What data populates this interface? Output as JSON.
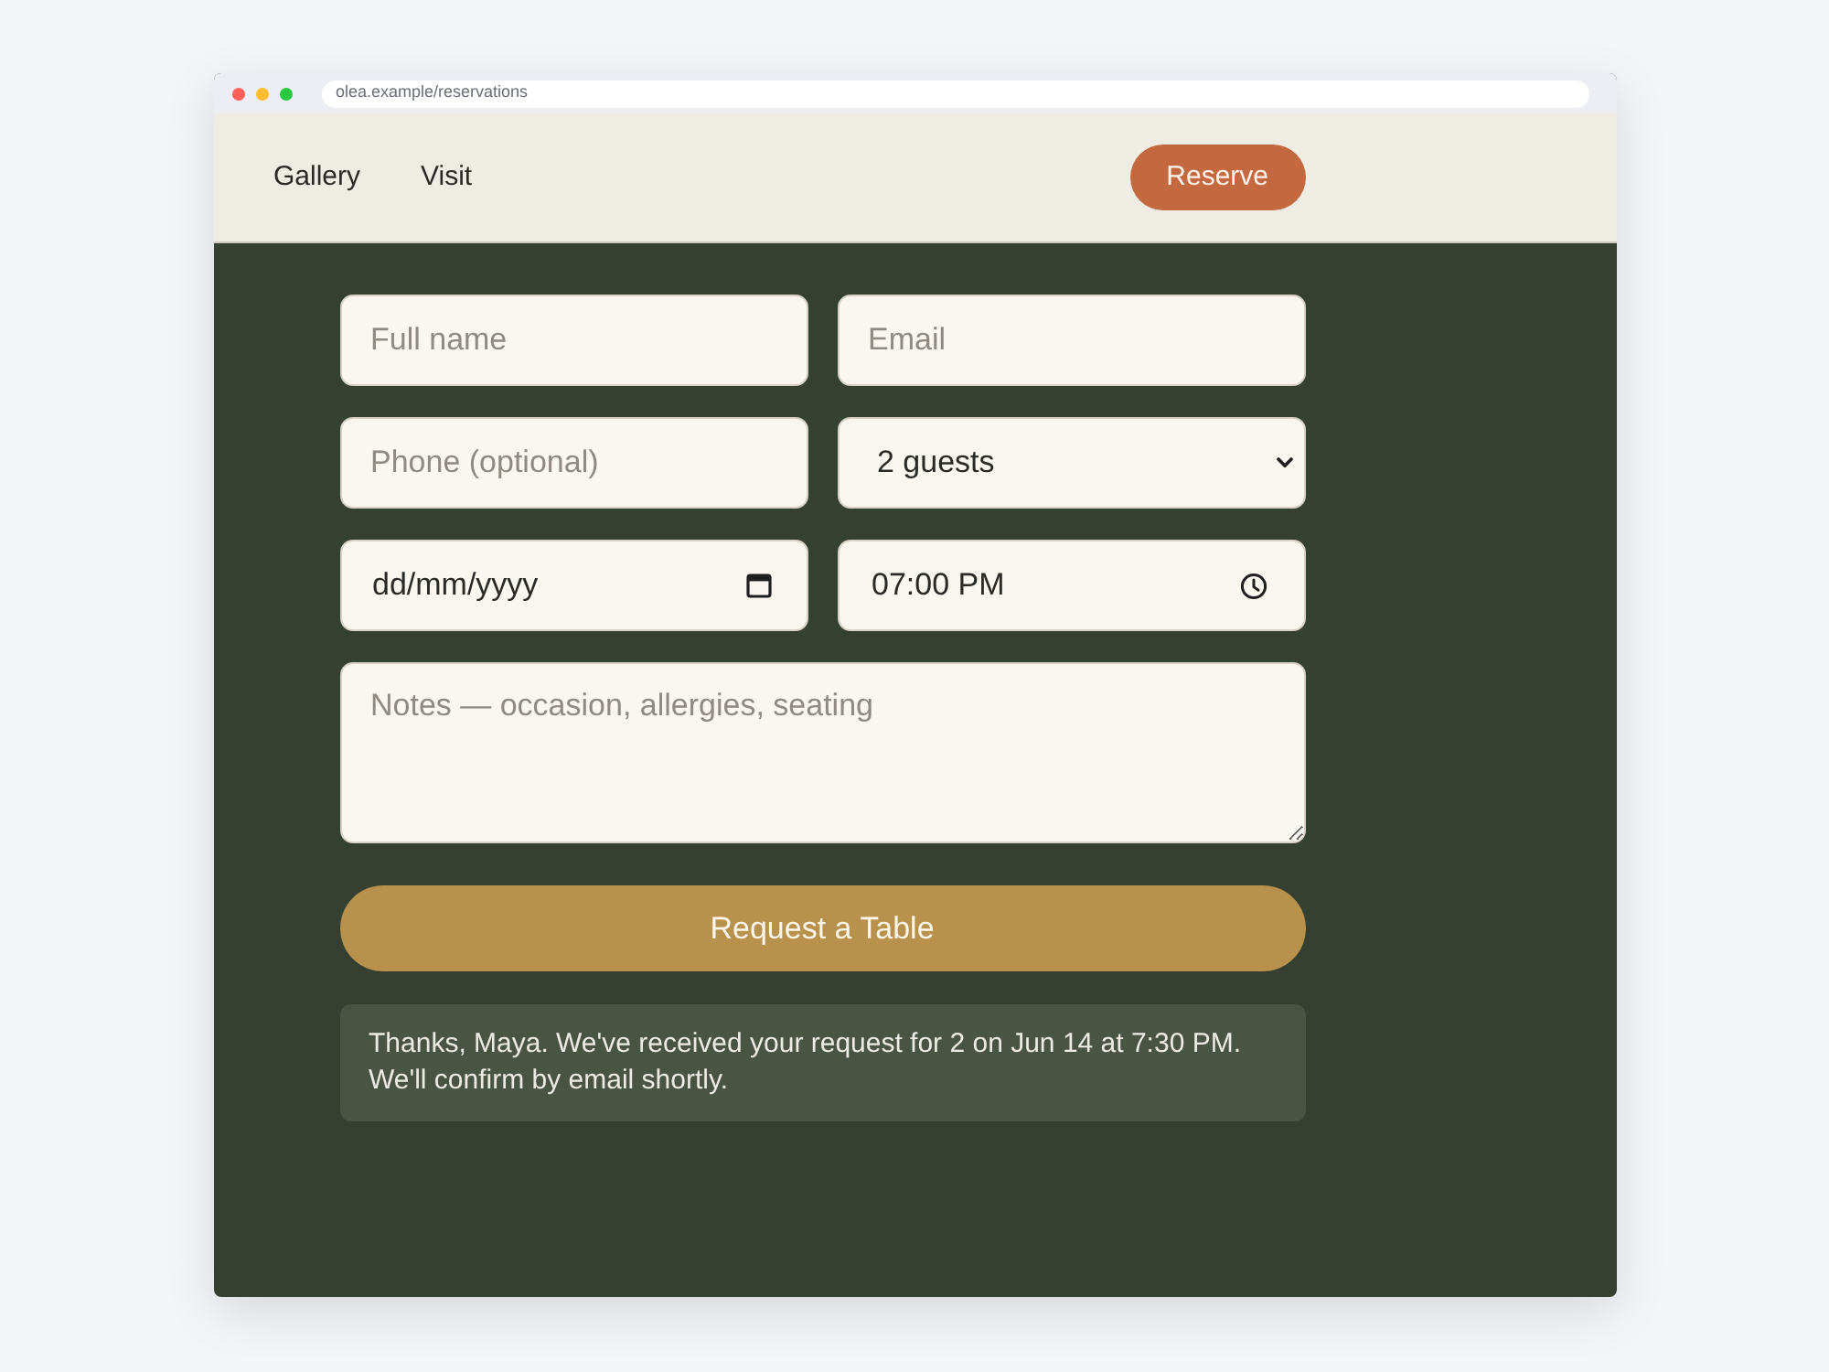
{
  "browser": {
    "url": "olea.example/reservations"
  },
  "nav": {
    "links": [
      "Gallery",
      "Visit"
    ],
    "cta": "Reserve"
  },
  "form": {
    "fields": [
      {
        "kind": "text",
        "placeholder": "Full name"
      },
      {
        "kind": "text",
        "placeholder": "Email"
      },
      {
        "kind": "text",
        "placeholder": "Phone (optional)"
      },
      {
        "kind": "select",
        "value": "2 guests"
      },
      {
        "kind": "date",
        "placeholder": "dd/mm/yyyy"
      },
      {
        "kind": "time",
        "value": "07:00 PM"
      },
      {
        "kind": "textarea",
        "placeholder": "Notes — occasion, allergies, seating"
      }
    ],
    "submit": "Request a Table"
  },
  "confirmation": "Thanks, Maya. We've received your request for 2 on Jun 14 at 7:30 PM. We'll confirm by email shortly."
}
